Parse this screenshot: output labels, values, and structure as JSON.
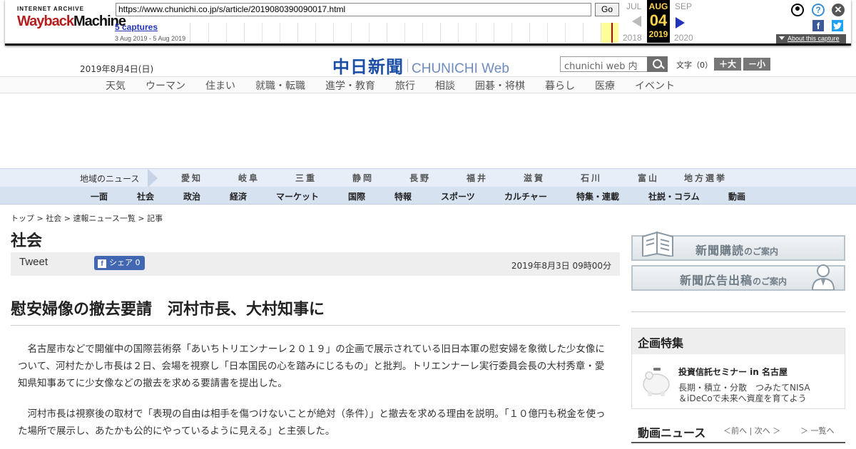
{
  "wayback": {
    "logo_top": "INTERNET ARCHIVE",
    "logo_a": "Wayback",
    "logo_b": "Machine",
    "url": "https://www.chunichi.co.jp/s/article/2019080390090017.html",
    "go_label": "Go",
    "captures_label": "5 captures",
    "capture_range": "3 Aug 2019 - 5 Aug 2019",
    "prev_month": "JUL",
    "current_month": "AUG",
    "next_month": "SEP",
    "current_day": "04",
    "prev_year": "2018",
    "current_year": "2019",
    "next_year": "2020",
    "help_label": "?",
    "close_label": "✕",
    "about_label": "About this capture",
    "icons": [
      "user-icon",
      "help-icon",
      "close-icon",
      "facebook-icon",
      "twitter-icon",
      "prev-arrow-icon",
      "next-arrow-icon"
    ]
  },
  "header": {
    "date": "2019年8月4日(日)",
    "logo_jp": "中日新聞",
    "logo_en": "CHUNICHI Web",
    "search_placeholder": "chunichi web 内",
    "font_size_label": "文字（0）",
    "font_plus": "＋大",
    "font_minus": "－小"
  },
  "top_nav": [
    "天気",
    "ウーマン",
    "住まい",
    "就職・転職",
    "進学・教育",
    "旅行",
    "相談",
    "囲碁・将棋",
    "暮らし",
    "医療",
    "イベント"
  ],
  "region": {
    "label": "地域のニュース",
    "items": [
      "愛知",
      "岐阜",
      "三重",
      "静岡",
      "長野",
      "福井",
      "滋賀",
      "石川",
      "富山",
      "地方選挙"
    ]
  },
  "genre": [
    "一面",
    "社会",
    "政治",
    "経済",
    "マーケット",
    "国際",
    "特報",
    "スポーツ",
    "カルチャー",
    "特集・連載",
    "社説・コラム",
    "動画"
  ],
  "article": {
    "breadcrumb": "トップ > 社会 > 速報ニュース一覧 > 記事",
    "section": "社会",
    "tweet_label": "Tweet",
    "share_label": "シェア",
    "share_count": "0",
    "published": "2019年8月3日 09時00分",
    "headline": "慰安婦像の撤去要請　河村市長、大村知事に",
    "paragraphs": [
      "名古屋市などで開催中の国際芸術祭「あいちトリエンナーレ２０１９」の企画で展示されている旧日本軍の慰安婦を象徴した少女像について、河村たかし市長は２日、会場を視察し「日本国民の心を踏みにじるもの」と批判。トリエンナーレ実行委員会長の大村秀章・愛知県知事あてに少女像などの撤去を求める要請書を提出した。",
      "河村市長は視察後の取材で「表現の自由は相手を傷つけないことが絶対（条件）」と撤去を求める理由を説明。「１０億円も税金を使った場所で展示し、あたかも公的にやっているように見える」と主張した。"
    ]
  },
  "sidebar": {
    "banner1_main": "新聞購読",
    "banner1_sub": "のご案内",
    "banner2_main": "新聞広告出稿",
    "banner2_sub": "のご案内",
    "feature_heading": "企画特集",
    "feature_title": "投資信託セミナー in 名古屋",
    "feature_desc1": "長期・積立・分散　つみたてNISA",
    "feature_desc2": "＆iDeCoで未来へ資産を育てよう",
    "video_heading": "動画ニュース",
    "video_nav": "＜前へ | 次へ ＞",
    "video_list": "＞ 一覧へ"
  },
  "colors": {
    "wayback_red": "#b41e1e",
    "logo_blue": "#1b4fa6",
    "region_bar": "#e8eef7",
    "genre_bar": "#d7e2f1",
    "facebook_blue": "#4267b2"
  }
}
